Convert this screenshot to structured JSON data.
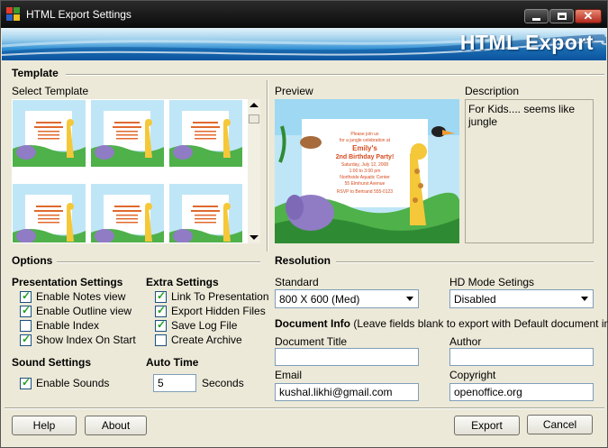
{
  "window": {
    "title": "HTML Export Settings",
    "banner_title": "HTML Export",
    "controls": {
      "minimize": "—",
      "maximize": "□",
      "close": "✕"
    }
  },
  "template": {
    "section_title": "Template",
    "select_label": "Select Template",
    "thumbnails_count_visible": 6,
    "preview_label": "Preview",
    "description_label": "Description",
    "description_text": "For Kids.... seems like jungle",
    "preview_card": {
      "line1": "Please join us",
      "line2": "for a jungle celebration at",
      "name": "Emily's",
      "headline": "2nd Birthday Party!",
      "date": "Saturday, July 12, 2008",
      "time": "1:00 to 3:00 pm",
      "place": "Northside Aquatic Center",
      "address": "55 Elmhurst Avenue",
      "rsvp": "RSVP to Bertrand 555-0123"
    }
  },
  "options": {
    "section_title": "Options",
    "presentation": {
      "title": "Presentation Settings",
      "items": [
        {
          "label": "Enable Notes view",
          "checked": true
        },
        {
          "label": "Enable Outline view",
          "checked": true
        },
        {
          "label": "Enable Index",
          "checked": false
        },
        {
          "label": "Show Index On Start",
          "checked": true
        }
      ]
    },
    "extra": {
      "title": "Extra Settings",
      "items": [
        {
          "label": "Link To Presentation",
          "checked": true
        },
        {
          "label": "Export Hidden Files",
          "checked": true
        },
        {
          "label": "Save Log File",
          "checked": true
        },
        {
          "label": "Create Archive",
          "checked": false
        }
      ]
    },
    "sound": {
      "title": "Sound Settings",
      "items": [
        {
          "label": "Enable Sounds",
          "checked": true
        }
      ]
    },
    "auto_time": {
      "title": "Auto Time",
      "value": "5",
      "unit": "Seconds"
    }
  },
  "resolution": {
    "section_title": "Resolution",
    "standard_label": "Standard",
    "standard_value": "800 X 600 (Med)",
    "hd_label": "HD Mode Setings",
    "hd_value": "Disabled"
  },
  "document_info": {
    "title": "Document Info",
    "hint": "(Leave fields blank to export with Default document info)",
    "document_title_label": "Document Title",
    "document_title_value": "",
    "author_label": "Author",
    "author_value": "",
    "email_label": "Email",
    "email_value": "kushal.likhi@gmail.com",
    "copyright_label": "Copyright",
    "copyright_value": "openoffice.org"
  },
  "buttons": {
    "help": "Help",
    "about": "About",
    "export": "Export",
    "cancel": "Cancel"
  },
  "colors": {
    "window_bg": "#ece9d8",
    "banner_blue": "#2f8fd3",
    "check_green": "#21a121"
  }
}
